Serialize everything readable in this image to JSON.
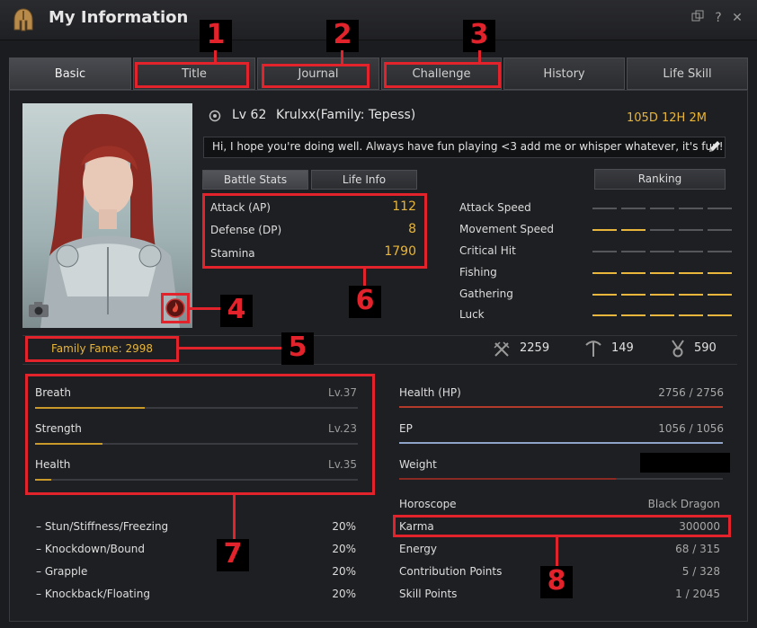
{
  "window": {
    "title": "My Information",
    "icons": {
      "app": "helmet-icon",
      "restore": "restore-icon",
      "help": "help-icon",
      "close": "close-icon"
    },
    "help_glyph": "?",
    "close_glyph": "✕"
  },
  "tabs": [
    {
      "label": "Basic",
      "active": true
    },
    {
      "label": "Title"
    },
    {
      "label": "Journal"
    },
    {
      "label": "Challenge"
    },
    {
      "label": "History"
    },
    {
      "label": "Life Skill"
    }
  ],
  "profile": {
    "level_prefix": "Lv",
    "level": "62",
    "name": "Krulxx(Family: Tepess)",
    "playtime": {
      "d": "105",
      "d_unit": "D",
      "h": "12",
      "h_unit": "H",
      "m": "2",
      "m_unit": "M"
    },
    "greeting": "Hi, I hope you're doing well. Always have fun playing <3 add me or whisper whatever, it's fun!"
  },
  "subtabs": {
    "battle": "Battle Stats",
    "life": "Life Info",
    "ranking": "Ranking"
  },
  "combat": [
    {
      "label": "Attack (AP)",
      "value": "112"
    },
    {
      "label": "Defense (DP)",
      "value": "8"
    },
    {
      "label": "Stamina",
      "value": "1790"
    }
  ],
  "speeds": [
    {
      "label": "Attack Speed",
      "level": 0
    },
    {
      "label": "Movement Speed",
      "level": 2
    },
    {
      "label": "Critical Hit",
      "level": 0
    },
    {
      "label": "Fishing",
      "level": 5
    },
    {
      "label": "Gathering",
      "level": 5
    },
    {
      "label": "Luck",
      "level": 5
    }
  ],
  "fame": {
    "label": "Family Fame",
    "value": "2998"
  },
  "fame_stats": [
    {
      "icon": "crossed-swords-icon",
      "value": "2259"
    },
    {
      "icon": "pickaxe-icon",
      "value": "149"
    },
    {
      "icon": "medal-icon",
      "value": "590"
    }
  ],
  "life_stats": [
    {
      "label": "Breath",
      "level": "Lv.37",
      "progress": 0.34
    },
    {
      "label": "Strength",
      "level": "Lv.23",
      "progress": 0.21
    },
    {
      "label": "Health",
      "level": "Lv.35",
      "progress": 0.05
    }
  ],
  "resistances": [
    {
      "label": "– Stun/Stiffness/Freezing",
      "value": "20%"
    },
    {
      "label": "– Knockdown/Bound",
      "value": "20%"
    },
    {
      "label": "– Grapple",
      "value": "20%"
    },
    {
      "label": "– Knockback/Floating",
      "value": "20%"
    }
  ],
  "right_stats": {
    "hp": {
      "label": "Health (HP)",
      "current": "2756",
      "max": "2756",
      "progress": 1.0
    },
    "ep": {
      "label": "EP",
      "current": "1056",
      "max": "1056",
      "progress": 1.0
    },
    "weight": {
      "label": "Weight",
      "progress": 0.67
    },
    "horoscope": {
      "label": "Horoscope",
      "value": "Black Dragon"
    },
    "karma": {
      "label": "Karma",
      "value": "300000"
    },
    "energy": {
      "label": "Energy",
      "current": "68",
      "max": "315"
    },
    "contribution": {
      "label": "Contribution Points",
      "current": "5",
      "max": "328"
    },
    "skill_points": {
      "label": "Skill Points",
      "current": "1",
      "max": "2045"
    }
  },
  "annotations": [
    "1",
    "2",
    "3",
    "4",
    "5",
    "6",
    "7",
    "8"
  ],
  "colors": {
    "gold": "#e8b63a",
    "annotation_red": "#e3232b",
    "background": "#1b1c1f"
  }
}
